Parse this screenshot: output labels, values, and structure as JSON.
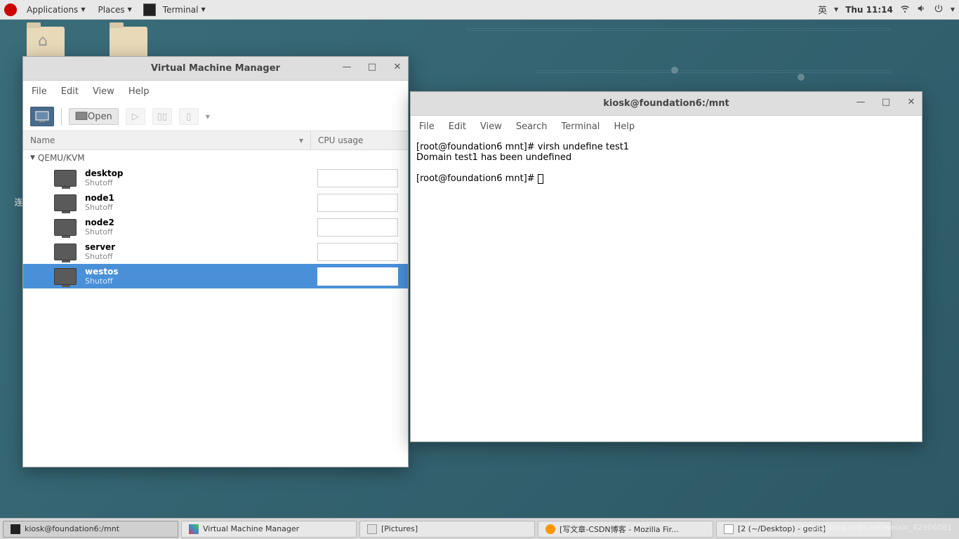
{
  "panel": {
    "applications": "Applications",
    "places": "Places",
    "terminal": "Terminal",
    "lang": "英",
    "time": "Thu 11:14"
  },
  "vmm": {
    "title": "Virtual Machine Manager",
    "menu": {
      "file": "File",
      "edit": "Edit",
      "view": "View",
      "help": "Help"
    },
    "toolbar": {
      "open": "Open"
    },
    "columns": {
      "name": "Name",
      "cpu": "CPU usage"
    },
    "hypervisor": "QEMU/KVM",
    "vms": [
      {
        "name": "desktop",
        "status": "Shutoff",
        "selected": false
      },
      {
        "name": "node1",
        "status": "Shutoff",
        "selected": false
      },
      {
        "name": "node2",
        "status": "Shutoff",
        "selected": false
      },
      {
        "name": "server",
        "status": "Shutoff",
        "selected": false
      },
      {
        "name": "westos",
        "status": "Shutoff",
        "selected": true
      }
    ]
  },
  "terminal": {
    "title": "kiosk@foundation6:/mnt",
    "menu": {
      "file": "File",
      "edit": "Edit",
      "view": "View",
      "search": "Search",
      "terminal": "Terminal",
      "help": "Help"
    },
    "lines": [
      "[root@foundation6 mnt]# virsh undefine test1",
      "Domain test1 has been undefined",
      "",
      "[root@foundation6 mnt]# "
    ]
  },
  "taskbar": {
    "items": [
      {
        "label": "kiosk@foundation6:/mnt",
        "icon": "term",
        "active": true
      },
      {
        "label": "Virtual Machine Manager",
        "icon": "vmm",
        "active": false
      },
      {
        "label": "[Pictures]",
        "icon": "pics",
        "active": false
      },
      {
        "label": "[写文章-CSDN博客 - Mozilla Fir...",
        "icon": "fox",
        "active": false
      },
      {
        "label": "[2 (~/Desktop) - gedit]",
        "icon": "gedit",
        "active": false
      }
    ]
  },
  "desktop_text": "连",
  "watermark": "https://blog.csdn.net/weixin_42906081"
}
